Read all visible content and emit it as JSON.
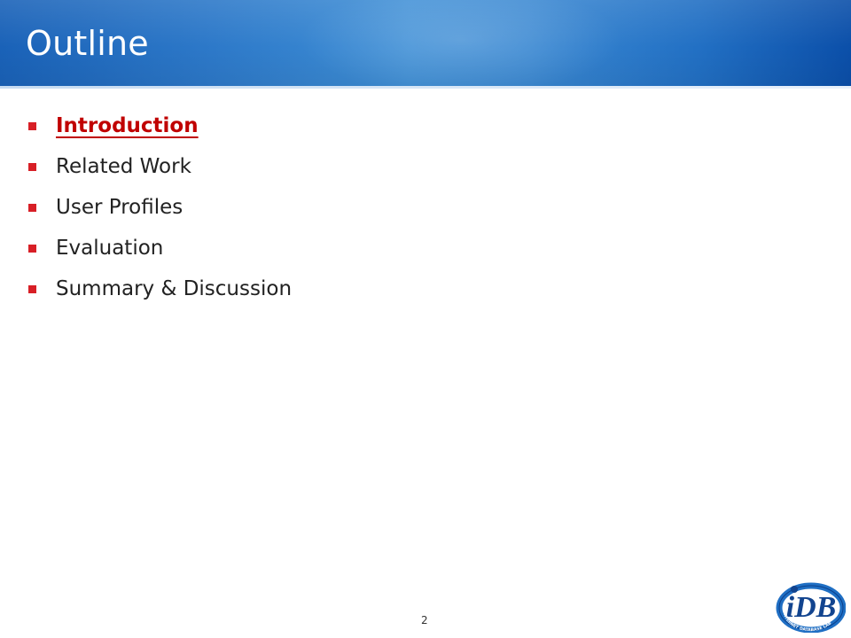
{
  "slide": {
    "title": "Outline",
    "page_number": "2"
  },
  "outline": {
    "items": [
      {
        "label": "Introduction",
        "active": true
      },
      {
        "label": "Related Work",
        "active": false
      },
      {
        "label": "User Profiles",
        "active": false
      },
      {
        "label": "Evaluation",
        "active": false
      },
      {
        "label": "Summary & Discussion",
        "active": false
      }
    ]
  },
  "colors": {
    "title_bar": "#2d79c9",
    "bullet": "#d81f26",
    "active_item": "#c00000",
    "text": "#222222"
  },
  "logo": {
    "text": "iDB",
    "ring_text": "INTERNET DATABASE LAB"
  }
}
